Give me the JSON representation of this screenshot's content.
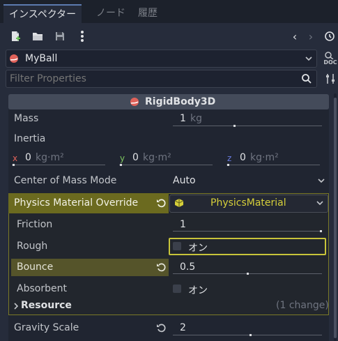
{
  "tabs": [
    {
      "label": "インスペクター",
      "active": true
    },
    {
      "label": "ノード",
      "active": false
    },
    {
      "label": "履歴",
      "active": false
    }
  ],
  "node_selector": {
    "value": "MyBall"
  },
  "filter": {
    "placeholder": "Filter Properties"
  },
  "side_labels": {
    "doc": "DOC"
  },
  "section": {
    "title": "RigidBody3D"
  },
  "mass": {
    "label": "Mass",
    "value": "1",
    "unit": "kg",
    "slider_fraction": 0.41
  },
  "inertia": {
    "label": "Inertia",
    "x": {
      "axis": "x",
      "value": "0",
      "unit": "kg·m²"
    },
    "y": {
      "axis": "y",
      "value": "0",
      "unit": "kg·m²"
    },
    "z": {
      "axis": "z",
      "value": "0",
      "unit": "kg·m²"
    }
  },
  "center_of_mass": {
    "label": "Center of Mass Mode",
    "value": "Auto"
  },
  "physics_material": {
    "label": "Physics Material Override",
    "value": "PhysicsMaterial"
  },
  "friction": {
    "label": "Friction",
    "value": "1",
    "slider_fraction": 1.0
  },
  "rough": {
    "label": "Rough",
    "toggle_text": "オン",
    "checked": false
  },
  "bounce": {
    "label": "Bounce",
    "value": "0.5",
    "slider_fraction": 0.5
  },
  "absorbent": {
    "label": "Absorbent",
    "toggle_text": "オン",
    "checked": false
  },
  "resource": {
    "label": "Resource",
    "changes": "(1 change)"
  },
  "gravity_scale": {
    "label": "Gravity Scale",
    "value": "2",
    "slider_fraction": 0.52
  },
  "colors": {
    "accent_olive": "#6b6a1f",
    "highlight_yellow": "#c8c43a",
    "node_red": "#e0625a"
  }
}
